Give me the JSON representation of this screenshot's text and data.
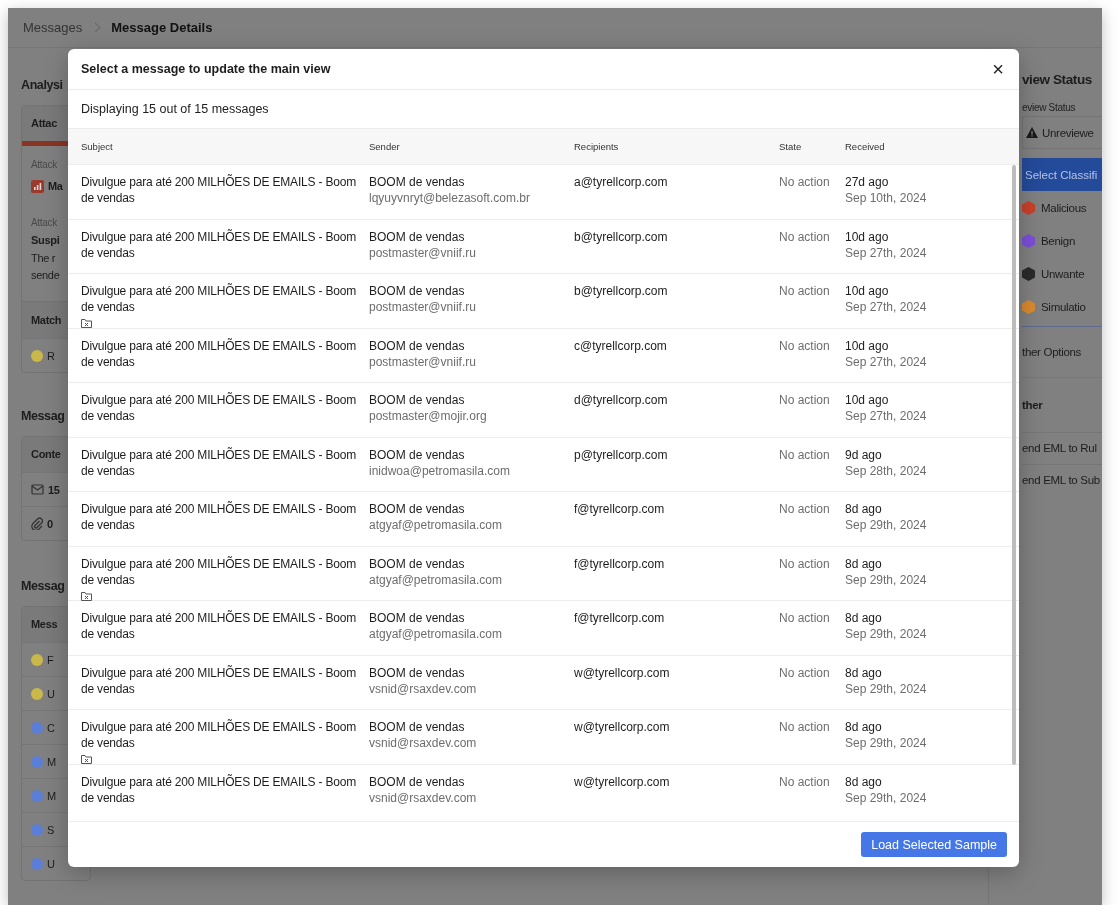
{
  "breadcrumb": [
    {
      "label": "Messages",
      "current": false
    },
    {
      "label": "Message Details",
      "current": true
    }
  ],
  "left_sections": [
    {
      "heading": "Analysi",
      "card": {
        "header": "Attac",
        "accent": true,
        "rows": [
          {
            "kind": "label",
            "text": "Attack"
          },
          {
            "kind": "chart",
            "text": "Ma"
          },
          {
            "kind": "label",
            "text": "Attack"
          },
          {
            "kind": "title",
            "text": "Suspi"
          },
          {
            "kind": "text",
            "text": "The r"
          },
          {
            "kind": "text",
            "text": "sende"
          },
          {
            "kind": "subheader",
            "text": "Match"
          },
          {
            "kind": "dot",
            "text": "R",
            "color": "#c9b84a"
          }
        ]
      }
    },
    {
      "heading": "Messag",
      "card": {
        "header": "Conte",
        "accent": false,
        "rows": [
          {
            "kind": "mail",
            "text": "15"
          },
          {
            "kind": "clip",
            "text": "0"
          }
        ]
      }
    },
    {
      "heading": "Messag",
      "card": {
        "header": "Mess",
        "accent": false,
        "rows": [
          {
            "kind": "dot",
            "text": "F",
            "color": "#c9b84a"
          },
          {
            "kind": "dot",
            "text": "U",
            "color": "#c9b84a"
          },
          {
            "kind": "dot",
            "text": "C",
            "color": "#5b7fd6"
          },
          {
            "kind": "dot",
            "text": "M",
            "color": "#5b7fd6"
          },
          {
            "kind": "dot",
            "text": "M",
            "color": "#5b7fd6"
          },
          {
            "kind": "dot",
            "text": "S",
            "color": "#5b7fd6"
          },
          {
            "kind": "dot",
            "text": "U",
            "color": "#5b7fd6"
          }
        ]
      }
    }
  ],
  "sidebar": {
    "heading": "view Status",
    "field_label": "eview Status",
    "status": "Unreviewe",
    "classify_button": "Select Classifi",
    "classifications": [
      {
        "label": "Malicious",
        "color": "#c8402a"
      },
      {
        "label": "Benign",
        "color": "#7b4fd8"
      },
      {
        "label": "Unwante",
        "color": "#2a2a2a"
      },
      {
        "label": "Simulatio",
        "color": "#d98a2e"
      }
    ],
    "other_options": "ther Options",
    "other_heading": "ther",
    "actions": [
      "end EML to Rul",
      "end EML to Sub"
    ]
  },
  "modal": {
    "title": "Select a message to update the main view",
    "close": "×",
    "count": "Displaying 15 out of 15 messages",
    "columns": [
      "Subject",
      "Sender",
      "Recipients",
      "State",
      "Received"
    ],
    "rows": [
      {
        "subject": "Divulgue para até 200 MILHÕES DE EMAILS - Boom de vendas",
        "sender": "BOOM de vendas",
        "sender_email": "lqyuyvnryt@belezasoft.com.br",
        "recipient": "a@tyrellcorp.com",
        "state": "No action",
        "ago": "27d ago",
        "date": "Sep 10th, 2024",
        "folder_mark": false
      },
      {
        "subject": "Divulgue para até 200 MILHÕES DE EMAILS - Boom de vendas",
        "sender": "BOOM de vendas",
        "sender_email": "postmaster@vniif.ru",
        "recipient": "b@tyrellcorp.com",
        "state": "No action",
        "ago": "10d ago",
        "date": "Sep 27th, 2024",
        "folder_mark": false
      },
      {
        "subject": "Divulgue para até 200 MILHÕES DE EMAILS - Boom de vendas",
        "sender": "BOOM de vendas",
        "sender_email": "postmaster@vniif.ru",
        "recipient": "b@tyrellcorp.com",
        "state": "No action",
        "ago": "10d ago",
        "date": "Sep 27th, 2024",
        "folder_mark": true
      },
      {
        "subject": "Divulgue para até 200 MILHÕES DE EMAILS - Boom de vendas",
        "sender": "BOOM de vendas",
        "sender_email": "postmaster@vniif.ru",
        "recipient": "c@tyrellcorp.com",
        "state": "No action",
        "ago": "10d ago",
        "date": "Sep 27th, 2024",
        "folder_mark": false
      },
      {
        "subject": "Divulgue para até 200 MILHÕES DE EMAILS - Boom de vendas",
        "sender": "BOOM de vendas",
        "sender_email": "postmaster@mojir.org",
        "recipient": "d@tyrellcorp.com",
        "state": "No action",
        "ago": "10d ago",
        "date": "Sep 27th, 2024",
        "folder_mark": false
      },
      {
        "subject": "Divulgue para até 200 MILHÕES DE EMAILS - Boom de vendas",
        "sender": "BOOM de vendas",
        "sender_email": "inidwoa@petromasila.com",
        "recipient": "p@tyrellcorp.com",
        "state": "No action",
        "ago": "9d ago",
        "date": "Sep 28th, 2024",
        "folder_mark": false
      },
      {
        "subject": "Divulgue para até 200 MILHÕES DE EMAILS - Boom de vendas",
        "sender": "BOOM de vendas",
        "sender_email": "atgyaf@petromasila.com",
        "recipient": "f@tyrellcorp.com",
        "state": "No action",
        "ago": "8d ago",
        "date": "Sep 29th, 2024",
        "folder_mark": false
      },
      {
        "subject": "Divulgue para até 200 MILHÕES DE EMAILS - Boom de vendas",
        "sender": "BOOM de vendas",
        "sender_email": "atgyaf@petromasila.com",
        "recipient": "f@tyrellcorp.com",
        "state": "No action",
        "ago": "8d ago",
        "date": "Sep 29th, 2024",
        "folder_mark": true
      },
      {
        "subject": "Divulgue para até 200 MILHÕES DE EMAILS - Boom de vendas",
        "sender": "BOOM de vendas",
        "sender_email": "atgyaf@petromasila.com",
        "recipient": "f@tyrellcorp.com",
        "state": "No action",
        "ago": "8d ago",
        "date": "Sep 29th, 2024",
        "folder_mark": false
      },
      {
        "subject": "Divulgue para até 200 MILHÕES DE EMAILS - Boom de vendas",
        "sender": "BOOM de vendas",
        "sender_email": "vsnid@rsaxdev.com",
        "recipient": "w@tyrellcorp.com",
        "state": "No action",
        "ago": "8d ago",
        "date": "Sep 29th, 2024",
        "folder_mark": false
      },
      {
        "subject": "Divulgue para até 200 MILHÕES DE EMAILS - Boom de vendas",
        "sender": "BOOM de vendas",
        "sender_email": "vsnid@rsaxdev.com",
        "recipient": "w@tyrellcorp.com",
        "state": "No action",
        "ago": "8d ago",
        "date": "Sep 29th, 2024",
        "folder_mark": true
      },
      {
        "subject": "Divulgue para até 200 MILHÕES DE EMAILS - Boom de vendas",
        "sender": "BOOM de vendas",
        "sender_email": "vsnid@rsaxdev.com",
        "recipient": "w@tyrellcorp.com",
        "state": "No action",
        "ago": "8d ago",
        "date": "Sep 29th, 2024",
        "folder_mark": false
      }
    ],
    "load_button": "Load Selected Sample"
  }
}
